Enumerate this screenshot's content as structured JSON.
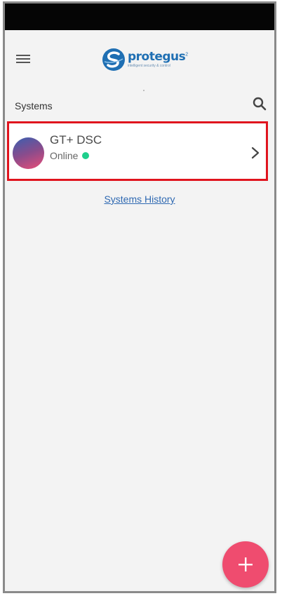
{
  "colors": {
    "status_bar": "#050505",
    "background": "#f3f3f3",
    "highlight_border": "#e0141e",
    "online_dot": "#1ecf8c",
    "link": "#2f69b2",
    "fab": "#ef4c6f",
    "brand": "#1f6fb3"
  },
  "header": {
    "menu_icon": "hamburger-menu-icon",
    "logo_text": "protegus",
    "logo_superscript": "2",
    "logo_tagline": "intelligent security & control"
  },
  "systems": {
    "title": "Systems",
    "search_icon": "search-icon",
    "items": [
      {
        "name": "GT+ DSC",
        "status": "Online",
        "status_icon": "online-dot-icon",
        "nav_icon": "chevron-right-icon"
      }
    ],
    "history_link": "Systems History"
  },
  "fab": {
    "icon": "plus-icon"
  }
}
